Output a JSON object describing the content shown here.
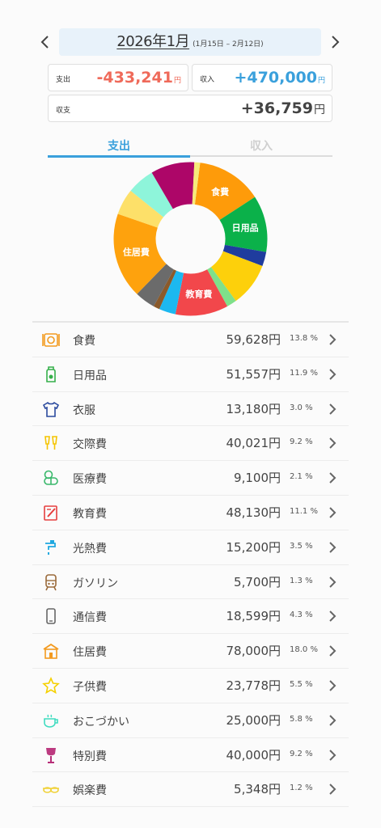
{
  "header": {
    "month": "2026年1月",
    "range": "(1月15日 – 2月12日)"
  },
  "summary": {
    "expense_label": "支出",
    "expense_value": "-433,241",
    "income_label": "収入",
    "income_value": "+470,000",
    "balance_label": "収支",
    "balance_value": "+36,759",
    "unit": "円"
  },
  "tabs": {
    "expense": "支出",
    "income": "収入"
  },
  "colors": {
    "accent": "#3aa0dc",
    "expense": "#ef6a5a"
  },
  "chart_data": {
    "type": "pie",
    "style": "donut",
    "labels_shown": [
      "食費",
      "日用品",
      "教育費",
      "住居費"
    ],
    "slices": [
      {
        "label": "食費",
        "value": 13.8,
        "color": "#fe9b0a"
      },
      {
        "label": "日用品",
        "value": 11.9,
        "color": "#0bb14a"
      },
      {
        "label": "衣服",
        "value": 3.0,
        "color": "#1f3c9e"
      },
      {
        "label": "交際費",
        "value": 9.2,
        "color": "#fdd00b"
      },
      {
        "label": "医療費",
        "value": 2.1,
        "color": "#7fe08a"
      },
      {
        "label": "教育費",
        "value": 11.1,
        "color": "#f2474b"
      },
      {
        "label": "光熱費",
        "value": 3.5,
        "color": "#1cb8f0"
      },
      {
        "label": "ガソリン",
        "value": 1.3,
        "color": "#8a5a2b"
      },
      {
        "label": "通信費",
        "value": 4.3,
        "color": "#6b6b6b"
      },
      {
        "label": "住居費",
        "value": 18.0,
        "color": "#fea20d"
      },
      {
        "label": "子供費",
        "value": 5.5,
        "color": "#fde069"
      },
      {
        "label": "おこづかい",
        "value": 5.8,
        "color": "#8ef5da"
      },
      {
        "label": "特別費",
        "value": 9.2,
        "color": "#ad0668"
      },
      {
        "label": "娯楽費",
        "value": 1.2,
        "color": "#f6eb7a"
      }
    ]
  },
  "categories": [
    {
      "name": "食費",
      "amount": "59,628円",
      "pct": "13.8 %",
      "icon": "dining-icon",
      "color": "#f39a1e"
    },
    {
      "name": "日用品",
      "amount": "51,557円",
      "pct": "11.9 %",
      "icon": "detergent-bottle-icon",
      "color": "#35b04a"
    },
    {
      "name": "衣服",
      "amount": "13,180円",
      "pct": "3.0 %",
      "icon": "tshirt-icon",
      "color": "#2b4a9e"
    },
    {
      "name": "交際費",
      "amount": "40,021円",
      "pct": "9.2 %",
      "icon": "cheers-icon",
      "color": "#f5c400"
    },
    {
      "name": "医療費",
      "amount": "9,100円",
      "pct": "2.1 %",
      "icon": "medicine-icon",
      "color": "#39b86b"
    },
    {
      "name": "教育費",
      "amount": "48,130円",
      "pct": "11.1 %",
      "icon": "notebook-pencil-icon",
      "color": "#e63f3f"
    },
    {
      "name": "光熱費",
      "amount": "15,200円",
      "pct": "3.5 %",
      "icon": "faucet-icon",
      "color": "#1fa8e0"
    },
    {
      "name": "ガソリン",
      "amount": "5,700円",
      "pct": "1.3 %",
      "icon": "train-icon",
      "color": "#9a6a3a"
    },
    {
      "name": "通信費",
      "amount": "18,599円",
      "pct": "4.3 %",
      "icon": "smartphone-icon",
      "color": "#666666"
    },
    {
      "name": "住居費",
      "amount": "78,000円",
      "pct": "18.0 %",
      "icon": "house-icon",
      "color": "#f39a1e"
    },
    {
      "name": "子供費",
      "amount": "23,778円",
      "pct": "5.5 %",
      "icon": "star-icon",
      "color": "#f5d000"
    },
    {
      "name": "おこづかい",
      "amount": "25,000円",
      "pct": "5.8 %",
      "icon": "coffee-cup-icon",
      "color": "#3fdcc0"
    },
    {
      "name": "特別費",
      "amount": "40,000円",
      "pct": "9.2 %",
      "icon": "wine-glass-icon",
      "color": "#b0186a"
    },
    {
      "name": "娯楽費",
      "amount": "5,348円",
      "pct": "1.2 %",
      "icon": "sunglasses-icon",
      "color": "#f0d23a"
    }
  ]
}
